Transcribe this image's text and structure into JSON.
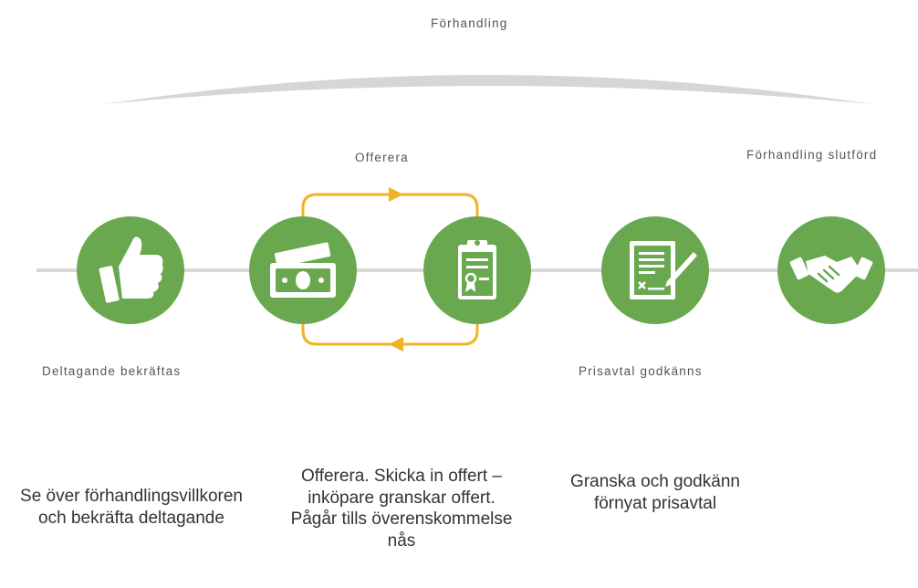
{
  "top_label": "Förhandling",
  "offer_loop_label": "Offerera",
  "steps": [
    {
      "icon": "thumbs-up-icon",
      "label": "Deltagande bekräftas"
    },
    {
      "icon": "money-icon",
      "label": ""
    },
    {
      "icon": "certificate-clipboard-icon",
      "label": ""
    },
    {
      "icon": "signed-document-icon",
      "label": "Prisavtal godkänns"
    },
    {
      "icon": "handshake-icon",
      "label": "Förhandling slutförd"
    }
  ],
  "descriptions": [
    "Se över förhandlingsvillkoren och bekräfta deltagande",
    "Offerera. Skicka in offert – inköpare granskar offert. Pågår tills överenskommelse nås",
    "Granska och godkänn förnyat prisavtal"
  ],
  "colors": {
    "circle": "#6aa84f",
    "loop": "#f0b323",
    "line": "#d9d9d9",
    "arc": "#d6d6d6"
  }
}
